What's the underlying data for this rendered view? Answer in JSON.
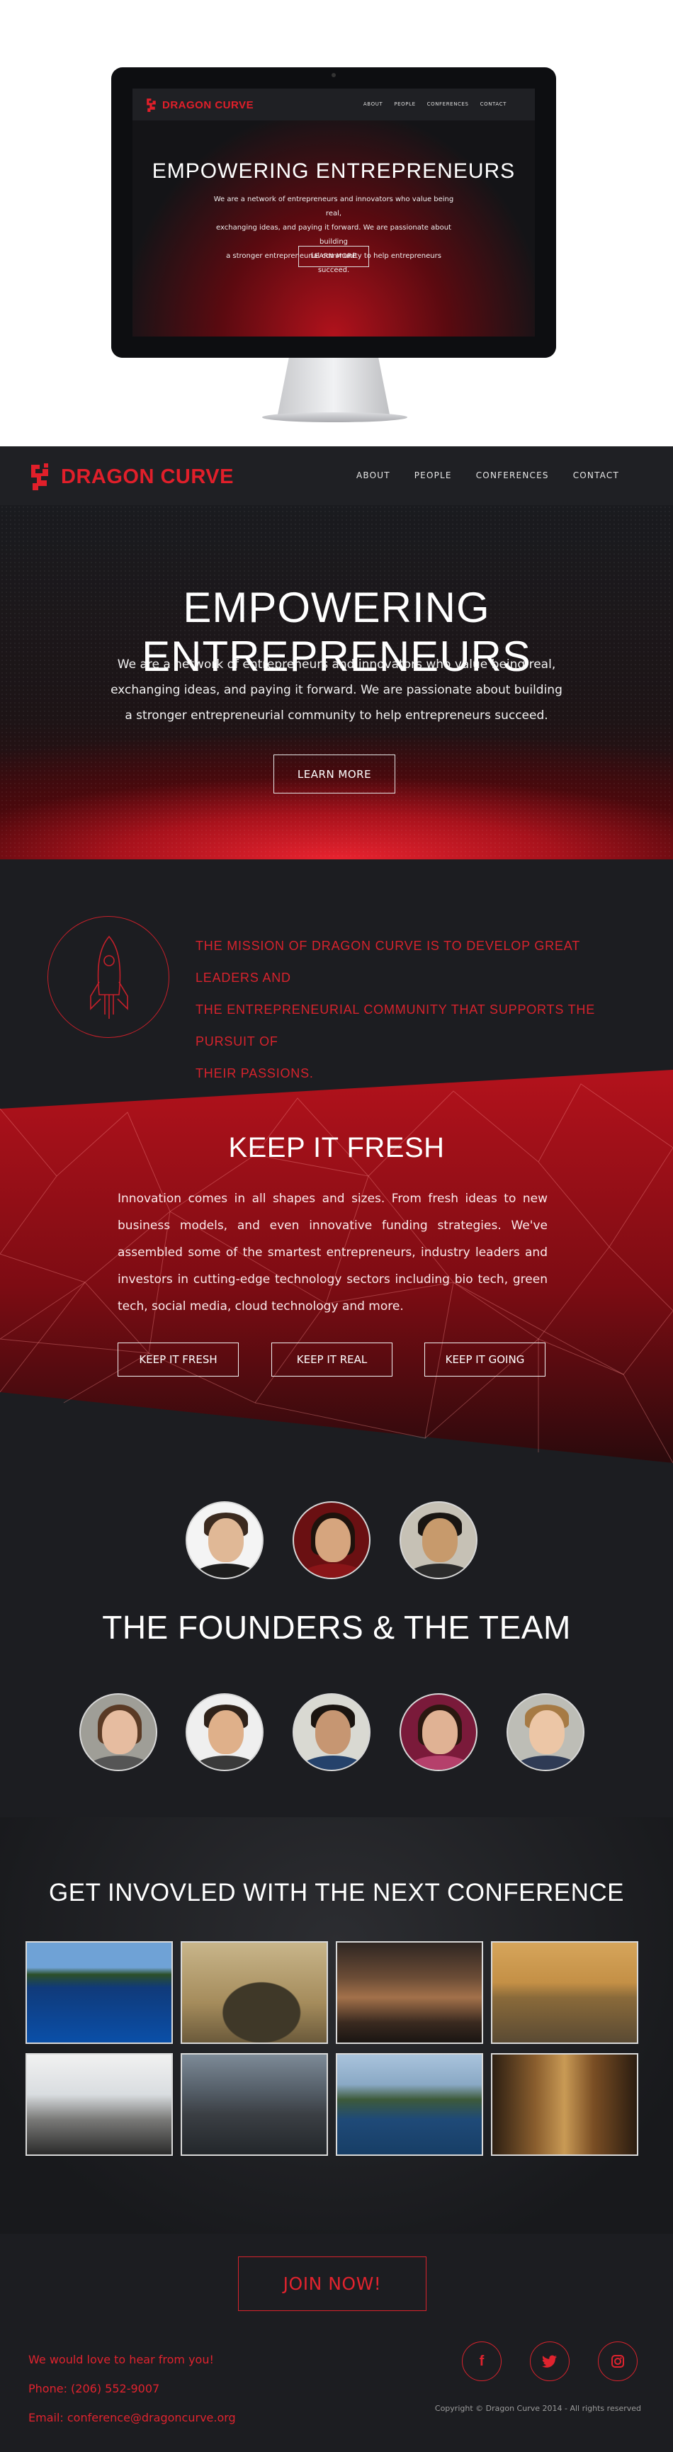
{
  "brand": {
    "name": "DRAGON CURVE",
    "accent": "#e11f2a"
  },
  "nav": {
    "items": [
      "ABOUT",
      "PEOPLE",
      "CONFERENCES",
      "CONTACT"
    ]
  },
  "hero": {
    "title": "EMPOWERING ENTREPRENEURS",
    "lines": [
      "We are a network of entrepreneurs and innovators who value being real,",
      "exchanging ideas, and paying it forward. We are passionate about building",
      "a stronger entrepreneurial community to help entrepreneurs succeed."
    ],
    "button": "LEARN MORE"
  },
  "mission": {
    "icon": "rocket-icon",
    "lines": [
      "THE MISSION OF DRAGON CURVE IS TO DEVELOP GREAT LEADERS AND",
      "THE ENTREPRENEURIAL COMMUNITY THAT SUPPORTS THE PURSUIT OF",
      "THEIR PASSIONS."
    ]
  },
  "fresh": {
    "title": "KEEP IT FRESH",
    "body": "Innovation comes in all shapes and sizes. From fresh ideas to new business models, and even innovative funding strategies. We've assembled some of the smartest entrepreneurs, industry leaders and investors in cutting-edge technology sectors including bio tech, green tech, social media, cloud technology and more.",
    "buttons": [
      "KEEP IT FRESH",
      "KEEP IT REAL",
      "KEEP IT GOING"
    ]
  },
  "team": {
    "title": "THE FOUNDERS & THE TEAM"
  },
  "conference": {
    "title": "GET INVOVLED WITH THE NEXT CONFERENCE"
  },
  "footer": {
    "join": "JOIN NOW!",
    "contact": [
      "We would love to hear from you!",
      "Phone: (206) 552-9007",
      "Email: conference@dragoncurve.org"
    ],
    "social": [
      "facebook-icon",
      "twitter-icon",
      "instagram-icon"
    ],
    "copyright": "Copyright © Dragon Curve 2014 - All rights reserved"
  }
}
